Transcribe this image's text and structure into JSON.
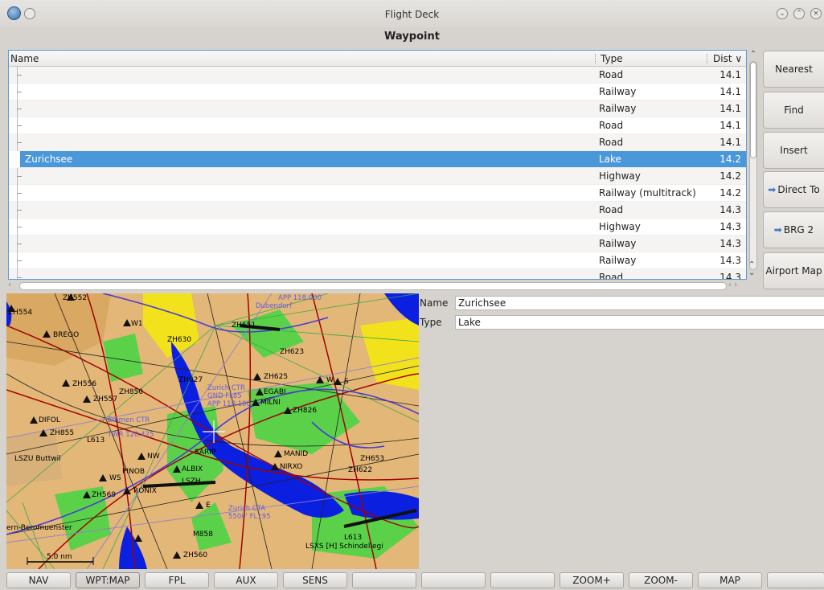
{
  "window": {
    "title": "Flight Deck"
  },
  "heading": "Waypoint",
  "list": {
    "columns": {
      "name": "Name",
      "type": "Type",
      "dist": "Dist ∨"
    },
    "rows": [
      {
        "name": "",
        "type": "Road",
        "dist": "14.1"
      },
      {
        "name": "",
        "type": "Railway",
        "dist": "14.1"
      },
      {
        "name": "",
        "type": "Railway",
        "dist": "14.1"
      },
      {
        "name": "",
        "type": "Road",
        "dist": "14.1"
      },
      {
        "name": "",
        "type": "Road",
        "dist": "14.1"
      },
      {
        "name": "Zurichsee",
        "type": "Lake",
        "dist": "14.2",
        "selected": true
      },
      {
        "name": "",
        "type": "Highway",
        "dist": "14.2"
      },
      {
        "name": "",
        "type": "Railway (multitrack)",
        "dist": "14.2"
      },
      {
        "name": "",
        "type": "Road",
        "dist": "14.3"
      },
      {
        "name": "",
        "type": "Highway",
        "dist": "14.3"
      },
      {
        "name": "",
        "type": "Railway",
        "dist": "14.3"
      },
      {
        "name": "",
        "type": "Railway",
        "dist": "14.3"
      },
      {
        "name": "",
        "type": "Road",
        "dist": "14.3"
      }
    ]
  },
  "side_buttons": {
    "nearest": "Nearest",
    "find": "Find",
    "insert": "Insert",
    "direct_to": "Direct To",
    "brg2": "BRG 2",
    "airport_map": "Airport Map"
  },
  "details": {
    "name_label": "Name",
    "name_value": "Zurichsee",
    "type_label": "Type",
    "type_value": "Lake"
  },
  "map_labels": {
    "zh552": "ZH552",
    "zh554": "ZH554",
    "w1": "W1",
    "brego": "BREGO",
    "zh556": "ZH556",
    "zh557": "ZH557",
    "zh850": "ZH850",
    "difol": "DIFOL",
    "zh855": "ZH855",
    "l613": "L613",
    "lszu": "LSZU Buttwil",
    "pinob": "PINOB",
    "ws": "WS",
    "roni": "RONIX",
    "zh569": "ZH569",
    "zh630": "ZH630",
    "zh627": "ZH627",
    "zh625": "ZH625",
    "egabi": "EGABI",
    "milni": "MILNI",
    "zh826": "ZH826",
    "sarip": "SARIP",
    "nw": "NW",
    "albix": "ALBIX",
    "manid": "MANID",
    "mrxo": "NIRXO",
    "lszh": "LSZH",
    "zh623": "ZH623",
    "s": "S",
    "w": "W",
    "e": "E",
    "zh653": "ZH653",
    "zh622": "ZH622",
    "l613b": "L613",
    "lsxs": "LSXS [H] Schindellegi",
    "m858": "M858",
    "zh560": "ZH560",
    "beromuenster": "ern-Beromuenster",
    "zurich_cta": "Zurich CTA",
    "fl": "5500' FL195",
    "app": "APP 118.000",
    "dubendorf": "Dubendorf",
    "zh651": "ZH651",
    "ctr": "Zurich CTR",
    "ctr_gnd": "GND FL85",
    "ctr_app": "APP 118.100",
    "emmen": "Emmen CTR",
    "twr": "TWR 120.425",
    "scale": "5.0 nm"
  },
  "bottom_buttons": [
    "NAV",
    "WPT:MAP",
    "FPL",
    "AUX",
    "SENS",
    "",
    "",
    "",
    "ZOOM+",
    "ZOOM-",
    "MAP",
    ""
  ],
  "colors": {
    "selection": "#4a97d9",
    "accent": "#5a9bd5",
    "lake": "#0a1fe0",
    "terrain": "#e3b777"
  }
}
